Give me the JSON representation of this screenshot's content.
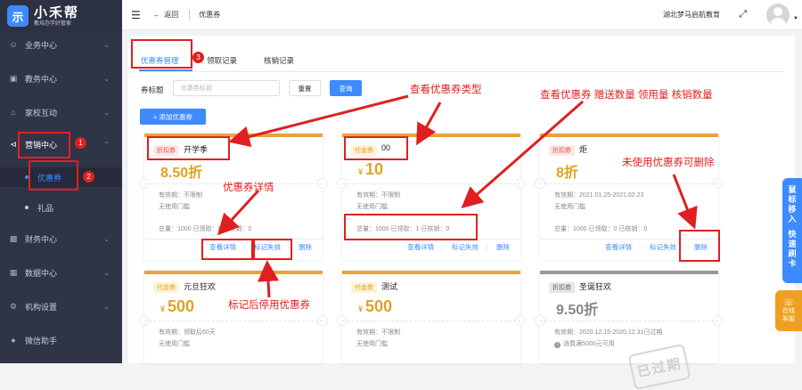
{
  "app": {
    "logo_glyph": "示",
    "name": "小禾帮",
    "slogan": "教培办学好管家"
  },
  "sidebar": {
    "items": [
      {
        "label": "业务中心",
        "icon": "user-icon"
      },
      {
        "label": "教务中心",
        "icon": "book-icon"
      },
      {
        "label": "家校互动",
        "icon": "home-icon"
      },
      {
        "label": "营销中心",
        "icon": "share-icon"
      },
      {
        "label": "财务中心",
        "icon": "wallet-icon"
      },
      {
        "label": "数据中心",
        "icon": "data-icon"
      },
      {
        "label": "机构设置",
        "icon": "gear-icon"
      },
      {
        "label": "微信助手",
        "icon": "wechat-icon"
      }
    ],
    "subitems": [
      {
        "label": "优惠券"
      },
      {
        "label": "礼品"
      }
    ]
  },
  "topbar": {
    "back_label": "返回",
    "breadcrumb": "优惠券",
    "org_name": "湖北梦马启航教育"
  },
  "tabs": [
    {
      "label": "优惠券管理"
    },
    {
      "label": "领取记录"
    },
    {
      "label": "核销记录"
    }
  ],
  "filter": {
    "label": "券标题",
    "placeholder": "优惠券标题",
    "reset_label": "重置",
    "search_label": "查询"
  },
  "add_button_label": "+ 添加优惠券",
  "cards": [
    {
      "type_label": "折扣券",
      "title": "开学季",
      "value": "8.50折",
      "validity": "有效期：不限制",
      "threshold": "无使用门槛",
      "stats": "总量：1000  已领取：0  已核销：0",
      "actions": [
        "查看详情",
        "标记失效",
        "删除"
      ]
    },
    {
      "type_label": "代金券",
      "title": "00",
      "currency": "¥",
      "value": "10",
      "validity": "有效期：不限制",
      "threshold": "无使用门槛",
      "stats": "总量：1000  已领取：1  已核销：0",
      "actions": [
        "查看详情",
        "标记失效",
        "删除"
      ]
    },
    {
      "type_label": "折扣券",
      "title": "炬",
      "value": "8折",
      "validity": "有效期：2021.01.25-2021.02.23",
      "threshold": "无使用门槛",
      "stats": "总量：1000  已领取：0  已核销：0",
      "actions": [
        "查看详情",
        "标记失效",
        "删除"
      ]
    },
    {
      "type_label": "代金券",
      "title": "元旦狂欢",
      "currency": "¥",
      "value": "500",
      "validity": "有效期：领取后60天",
      "threshold": "无使用门槛"
    },
    {
      "type_label": "代金券",
      "title": "测试",
      "currency": "¥",
      "value": "500",
      "validity": "有效期：不限制",
      "threshold": "无使用门槛"
    },
    {
      "type_label": "折扣券",
      "title": "圣诞狂欢",
      "value": "9.50折",
      "validity": "有效期：2020.12.15-2020.12.31已过期",
      "threshold": "消费满5000元可用",
      "stamp": "已过期"
    }
  ],
  "annotations": {
    "a1": "查看优惠券类型",
    "a2": "查看优惠券 赠送数量 领用量 核销数量",
    "a3": "优惠券详情",
    "a4": "未使用优惠券可删除",
    "a5": "标记后停用优惠券",
    "n1": "1",
    "n2": "2",
    "n3": "3"
  },
  "float": {
    "lines": [
      "鼠",
      "标",
      "移",
      "入",
      "",
      "快",
      "速",
      "刷",
      "卡"
    ],
    "service_lines": [
      "在线",
      "客服"
    ]
  },
  "colors": {
    "primary": "#3d8bff",
    "discount": "#e2534b",
    "voucher": "#e0a222",
    "stripe": "#e8a33d",
    "expired": "#999999",
    "sidebar": "#2f3447",
    "annotation": "#e02020"
  }
}
